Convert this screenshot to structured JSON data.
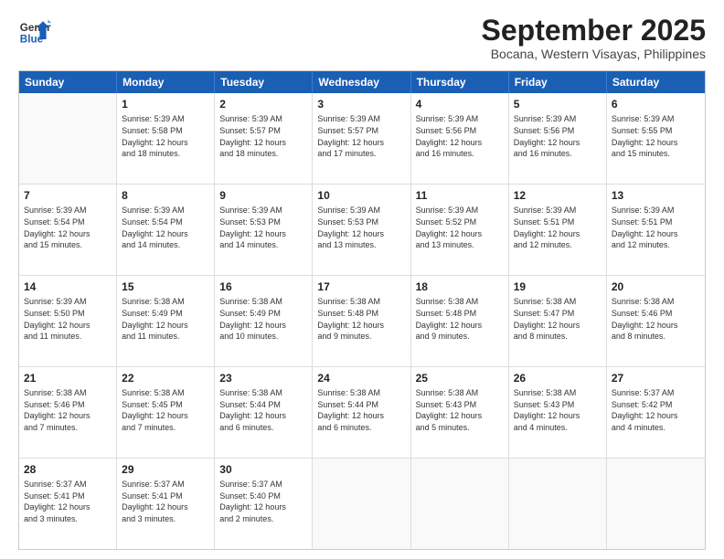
{
  "logo": {
    "line1": "General",
    "line2": "Blue"
  },
  "title": "September 2025",
  "subtitle": "Bocana, Western Visayas, Philippines",
  "header_days": [
    "Sunday",
    "Monday",
    "Tuesday",
    "Wednesday",
    "Thursday",
    "Friday",
    "Saturday"
  ],
  "weeks": [
    [
      {
        "day": "",
        "info": ""
      },
      {
        "day": "1",
        "info": "Sunrise: 5:39 AM\nSunset: 5:58 PM\nDaylight: 12 hours\nand 18 minutes."
      },
      {
        "day": "2",
        "info": "Sunrise: 5:39 AM\nSunset: 5:57 PM\nDaylight: 12 hours\nand 18 minutes."
      },
      {
        "day": "3",
        "info": "Sunrise: 5:39 AM\nSunset: 5:57 PM\nDaylight: 12 hours\nand 17 minutes."
      },
      {
        "day": "4",
        "info": "Sunrise: 5:39 AM\nSunset: 5:56 PM\nDaylight: 12 hours\nand 16 minutes."
      },
      {
        "day": "5",
        "info": "Sunrise: 5:39 AM\nSunset: 5:56 PM\nDaylight: 12 hours\nand 16 minutes."
      },
      {
        "day": "6",
        "info": "Sunrise: 5:39 AM\nSunset: 5:55 PM\nDaylight: 12 hours\nand 15 minutes."
      }
    ],
    [
      {
        "day": "7",
        "info": "Sunrise: 5:39 AM\nSunset: 5:54 PM\nDaylight: 12 hours\nand 15 minutes."
      },
      {
        "day": "8",
        "info": "Sunrise: 5:39 AM\nSunset: 5:54 PM\nDaylight: 12 hours\nand 14 minutes."
      },
      {
        "day": "9",
        "info": "Sunrise: 5:39 AM\nSunset: 5:53 PM\nDaylight: 12 hours\nand 14 minutes."
      },
      {
        "day": "10",
        "info": "Sunrise: 5:39 AM\nSunset: 5:53 PM\nDaylight: 12 hours\nand 13 minutes."
      },
      {
        "day": "11",
        "info": "Sunrise: 5:39 AM\nSunset: 5:52 PM\nDaylight: 12 hours\nand 13 minutes."
      },
      {
        "day": "12",
        "info": "Sunrise: 5:39 AM\nSunset: 5:51 PM\nDaylight: 12 hours\nand 12 minutes."
      },
      {
        "day": "13",
        "info": "Sunrise: 5:39 AM\nSunset: 5:51 PM\nDaylight: 12 hours\nand 12 minutes."
      }
    ],
    [
      {
        "day": "14",
        "info": "Sunrise: 5:39 AM\nSunset: 5:50 PM\nDaylight: 12 hours\nand 11 minutes."
      },
      {
        "day": "15",
        "info": "Sunrise: 5:38 AM\nSunset: 5:49 PM\nDaylight: 12 hours\nand 11 minutes."
      },
      {
        "day": "16",
        "info": "Sunrise: 5:38 AM\nSunset: 5:49 PM\nDaylight: 12 hours\nand 10 minutes."
      },
      {
        "day": "17",
        "info": "Sunrise: 5:38 AM\nSunset: 5:48 PM\nDaylight: 12 hours\nand 9 minutes."
      },
      {
        "day": "18",
        "info": "Sunrise: 5:38 AM\nSunset: 5:48 PM\nDaylight: 12 hours\nand 9 minutes."
      },
      {
        "day": "19",
        "info": "Sunrise: 5:38 AM\nSunset: 5:47 PM\nDaylight: 12 hours\nand 8 minutes."
      },
      {
        "day": "20",
        "info": "Sunrise: 5:38 AM\nSunset: 5:46 PM\nDaylight: 12 hours\nand 8 minutes."
      }
    ],
    [
      {
        "day": "21",
        "info": "Sunrise: 5:38 AM\nSunset: 5:46 PM\nDaylight: 12 hours\nand 7 minutes."
      },
      {
        "day": "22",
        "info": "Sunrise: 5:38 AM\nSunset: 5:45 PM\nDaylight: 12 hours\nand 7 minutes."
      },
      {
        "day": "23",
        "info": "Sunrise: 5:38 AM\nSunset: 5:44 PM\nDaylight: 12 hours\nand 6 minutes."
      },
      {
        "day": "24",
        "info": "Sunrise: 5:38 AM\nSunset: 5:44 PM\nDaylight: 12 hours\nand 6 minutes."
      },
      {
        "day": "25",
        "info": "Sunrise: 5:38 AM\nSunset: 5:43 PM\nDaylight: 12 hours\nand 5 minutes."
      },
      {
        "day": "26",
        "info": "Sunrise: 5:38 AM\nSunset: 5:43 PM\nDaylight: 12 hours\nand 4 minutes."
      },
      {
        "day": "27",
        "info": "Sunrise: 5:37 AM\nSunset: 5:42 PM\nDaylight: 12 hours\nand 4 minutes."
      }
    ],
    [
      {
        "day": "28",
        "info": "Sunrise: 5:37 AM\nSunset: 5:41 PM\nDaylight: 12 hours\nand 3 minutes."
      },
      {
        "day": "29",
        "info": "Sunrise: 5:37 AM\nSunset: 5:41 PM\nDaylight: 12 hours\nand 3 minutes."
      },
      {
        "day": "30",
        "info": "Sunrise: 5:37 AM\nSunset: 5:40 PM\nDaylight: 12 hours\nand 2 minutes."
      },
      {
        "day": "",
        "info": ""
      },
      {
        "day": "",
        "info": ""
      },
      {
        "day": "",
        "info": ""
      },
      {
        "day": "",
        "info": ""
      }
    ]
  ]
}
